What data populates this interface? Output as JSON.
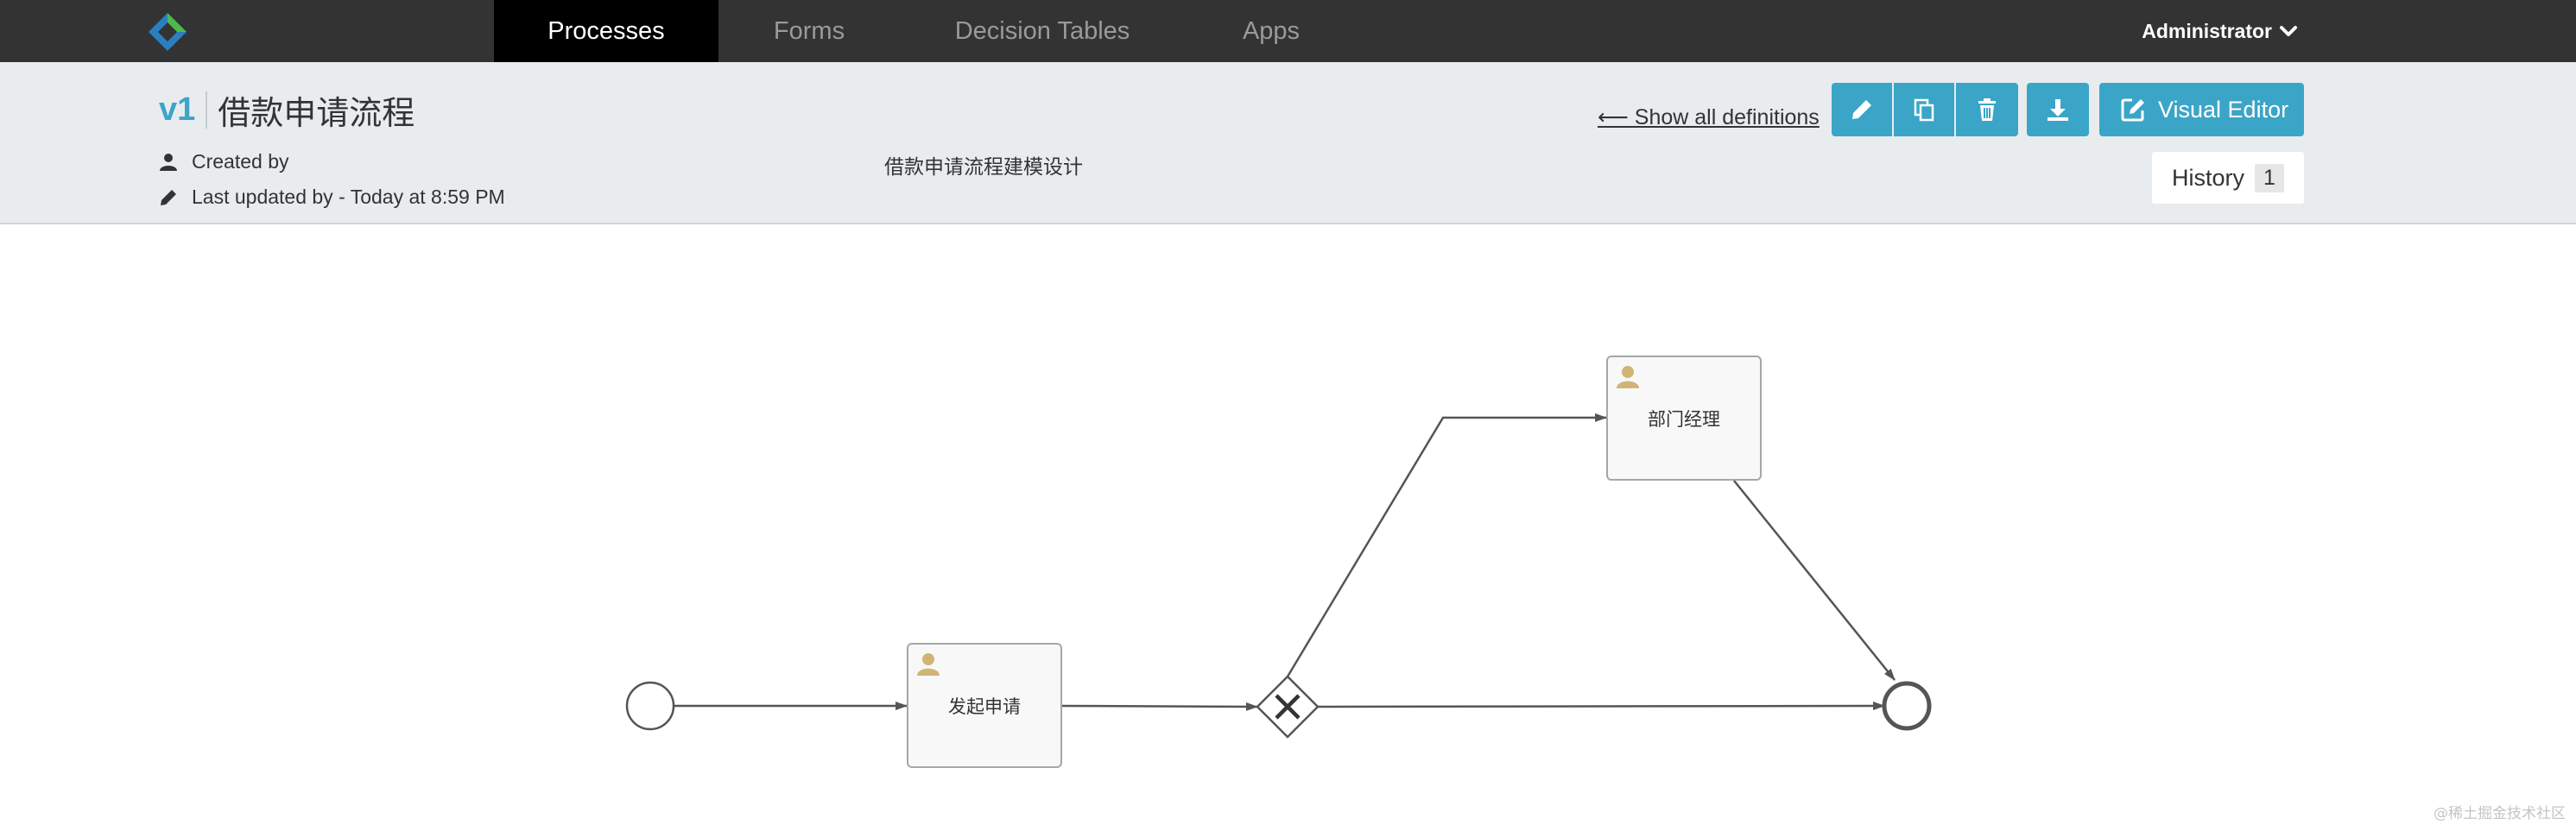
{
  "navbar": {
    "tabs": [
      {
        "label": "Processes",
        "active": true
      },
      {
        "label": "Forms",
        "active": false
      },
      {
        "label": "Decision Tables",
        "active": false
      },
      {
        "label": "Apps",
        "active": false
      }
    ],
    "user": "Administrator"
  },
  "header": {
    "version": "v1",
    "name": "借款申请流程",
    "created_by": "Created by",
    "last_updated": "Last updated by - Today at 8:59 PM",
    "description": "借款申请流程建模设计",
    "show_all": "⟵ Show all definitions",
    "visual_editor": "Visual Editor",
    "history_label": "History",
    "history_count": "1"
  },
  "diagram": {
    "tasks": [
      {
        "label": "发起申请",
        "type": "user-task"
      },
      {
        "label": "部门经理",
        "type": "user-task"
      }
    ]
  },
  "watermark": "@稀土掘金技术社区",
  "colors": {
    "navbar": "#333333",
    "accent": "#3ba5c7",
    "header_bg": "#e8ecee",
    "user_icon": "#d1b574"
  }
}
